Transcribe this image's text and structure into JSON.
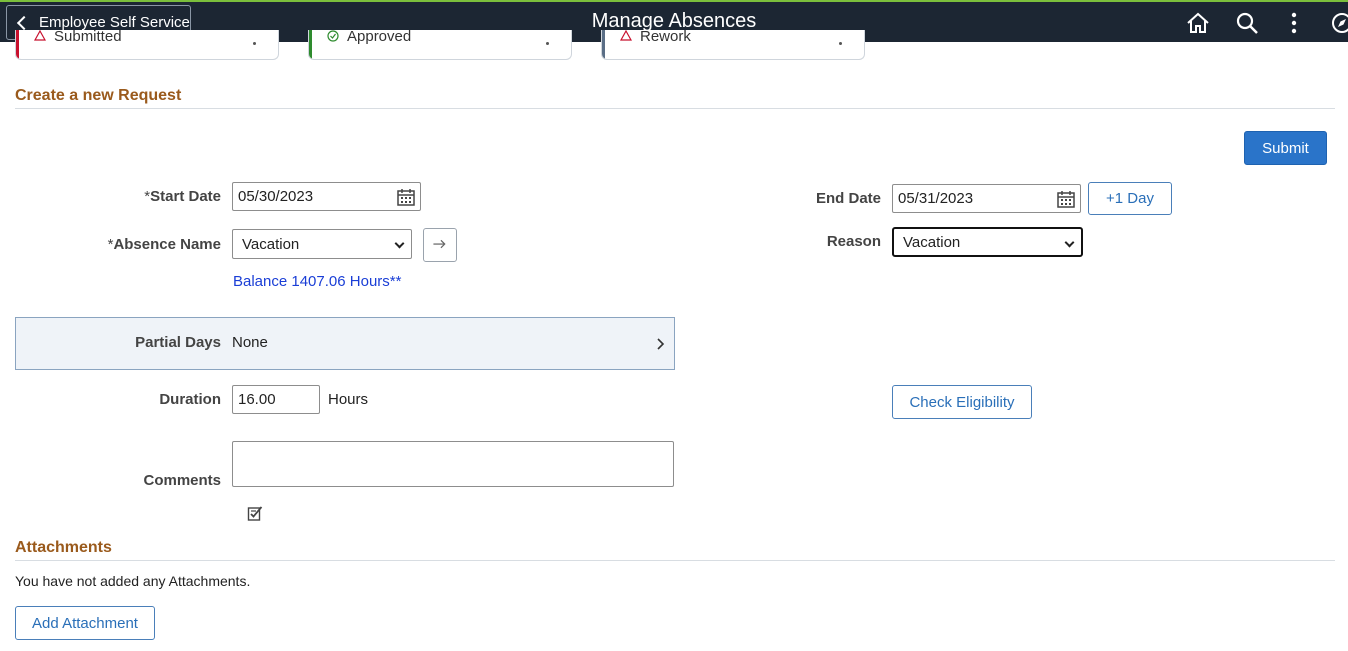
{
  "header": {
    "back_label": "Employee Self Service",
    "title": "Manage Absences",
    "icons": [
      "home-icon",
      "search-icon",
      "actions-menu-icon",
      "navbar-icon"
    ]
  },
  "tiles": [
    {
      "label": "Submitted",
      "color": "#c8102e"
    },
    {
      "label": "Approved",
      "color": "#2e8b2e"
    },
    {
      "label": "Rework",
      "color": "#5a6e86"
    }
  ],
  "section_create": {
    "heading": "Create a new Request",
    "submit_label": "Submit"
  },
  "form": {
    "start_date_req": "*",
    "start_date_label": "Start Date",
    "start_date_value": "05/30/2023",
    "end_date_label": "End Date",
    "end_date_value": "05/31/2023",
    "plus_day_label": "+1 Day",
    "absence_name_req": "*",
    "absence_name_label": "Absence Name",
    "absence_name_value": "Vacation",
    "reason_label": "Reason",
    "reason_value": "Vacation",
    "balance_text": "Balance 1407.06 Hours**",
    "partial_days_label": "Partial Days",
    "partial_days_value": "None",
    "duration_label": "Duration",
    "duration_value": "16.00",
    "duration_unit": "Hours",
    "check_eligibility_label": "Check Eligibility",
    "comments_label": "Comments",
    "comments_value": ""
  },
  "attachments": {
    "heading": "Attachments",
    "empty_text": "You have not added any Attachments.",
    "add_label": "Add Attachment"
  },
  "colors": {
    "header_bg": "#1c2633",
    "accent_heading": "#9a5a1c",
    "primary": "#2a74c9",
    "link": "#1a3ed6"
  }
}
